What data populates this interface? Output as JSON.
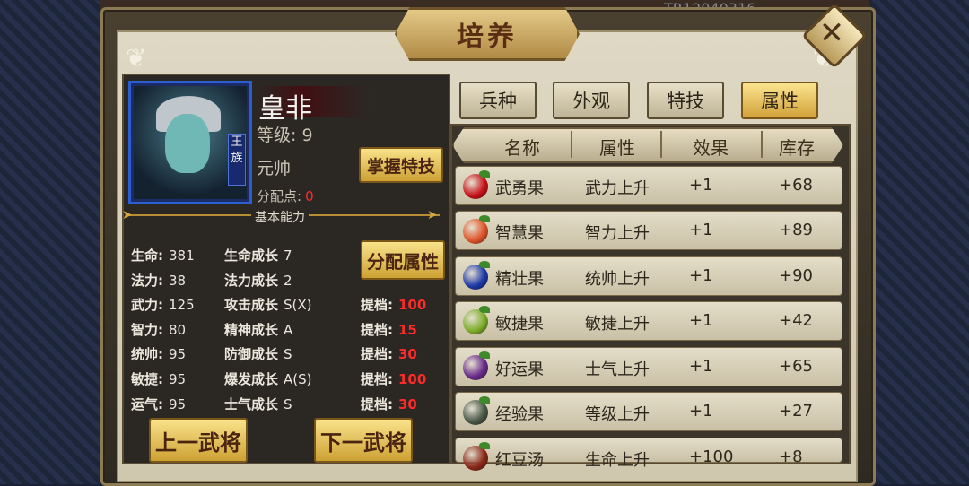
{
  "background": {
    "top_text": "TR12040316"
  },
  "window": {
    "title": "培养",
    "close_glyph": "✕"
  },
  "hero": {
    "name": "皇非",
    "level_label": "等级:",
    "level": "9",
    "rank": "元帅",
    "portrait_badge": "王族",
    "points_label": "分配点:",
    "points": "0"
  },
  "buttons": {
    "master_skill": "掌握特技",
    "assign_attr": "分配属性",
    "prev_general": "上一武将",
    "next_general": "下一武将"
  },
  "section": {
    "basic_ability": "基本能力"
  },
  "stats": [
    {
      "label": "生命:",
      "value": "381",
      "growth_label": "生命成长",
      "growth": "7",
      "raise_label": "",
      "raise": ""
    },
    {
      "label": "法力:",
      "value": "38",
      "growth_label": "法力成长",
      "growth": "2",
      "raise_label": "",
      "raise": ""
    },
    {
      "label": "武力:",
      "value": "125",
      "growth_label": "攻击成长",
      "growth": "S(X)",
      "raise_label": "提档:",
      "raise": "100"
    },
    {
      "label": "智力:",
      "value": "80",
      "growth_label": "精神成长",
      "growth": "A",
      "raise_label": "提档:",
      "raise": "15"
    },
    {
      "label": "统帅:",
      "value": "95",
      "growth_label": "防御成长",
      "growth": "S",
      "raise_label": "提档:",
      "raise": "30"
    },
    {
      "label": "敏捷:",
      "value": "95",
      "growth_label": "爆发成长",
      "growth": "A(S)",
      "raise_label": "提档:",
      "raise": "100"
    },
    {
      "label": "运气:",
      "value": "95",
      "growth_label": "士气成长",
      "growth": "S",
      "raise_label": "提档:",
      "raise": "30"
    }
  ],
  "tabs": [
    {
      "label": "兵种",
      "active": false
    },
    {
      "label": "外观",
      "active": false
    },
    {
      "label": "特技",
      "active": false
    },
    {
      "label": "属性",
      "active": true
    }
  ],
  "table": {
    "headers": [
      "名称",
      "属性",
      "效果",
      "库存"
    ],
    "rows": [
      {
        "name": "武勇果",
        "attr": "武力上升",
        "effect": "+1",
        "stock": "+68",
        "icon": "red-fruit-icon",
        "color": "#c8151b"
      },
      {
        "name": "智慧果",
        "attr": "智力上升",
        "effect": "+1",
        "stock": "+89",
        "icon": "orange-fruit-icon",
        "color": "#e0562a"
      },
      {
        "name": "精壮果",
        "attr": "统帅上升",
        "effect": "+1",
        "stock": "+90",
        "icon": "blue-fruit-icon",
        "color": "#1f3aa8"
      },
      {
        "name": "敏捷果",
        "attr": "敏捷上升",
        "effect": "+1",
        "stock": "+42",
        "icon": "green-fruit-icon",
        "color": "#7fae2c"
      },
      {
        "name": "好运果",
        "attr": "士气上升",
        "effect": "+1",
        "stock": "+65",
        "icon": "purple-fruit-icon",
        "color": "#6a2c8c"
      },
      {
        "name": "经验果",
        "attr": "等级上升",
        "effect": "+1",
        "stock": "+27",
        "icon": "vine-fruit-icon",
        "color": "#4b5a4a"
      },
      {
        "name": "红豆汤",
        "attr": "生命上升",
        "effect": "+100",
        "stock": "+8",
        "icon": "bean-soup-icon",
        "color": "#8c2a1a"
      }
    ]
  },
  "colors": {
    "accent_gold": "#d2a23a",
    "highlight_red": "#ff2a2a",
    "panel_dark": "#2b2824"
  }
}
